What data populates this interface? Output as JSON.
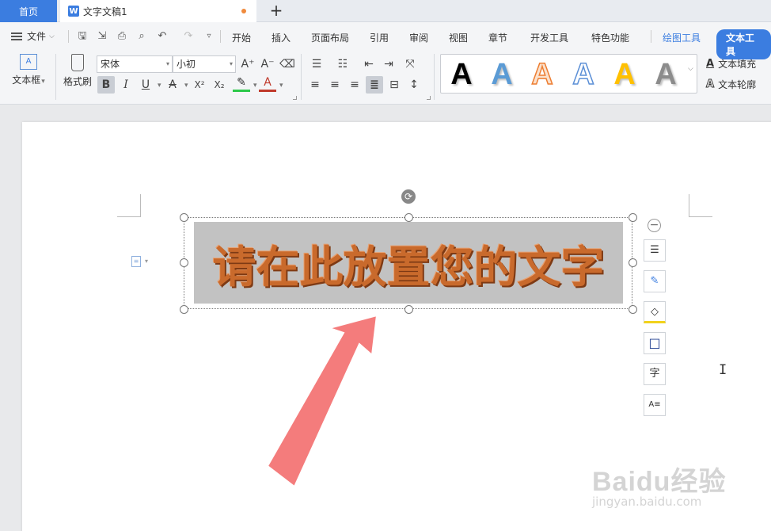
{
  "tabs": {
    "home": "首页",
    "doc_icon": "W",
    "doc_title": "文字文稿1",
    "new_tab": "+"
  },
  "menubar": {
    "file": "文件",
    "tabs": [
      "开始",
      "插入",
      "页面布局",
      "引用",
      "审阅",
      "视图",
      "章节",
      "开发工具",
      "特色功能"
    ],
    "drawing_tools": "绘图工具",
    "text_tools": "文本工具"
  },
  "toolbar": {
    "textbox_label": "文本框",
    "textbox_icon_glyph": "A",
    "format_painter_label": "格式刷",
    "font_name": "宋体",
    "font_size": "小初",
    "bold": "B",
    "italic": "I",
    "underline": "U",
    "strike": "A",
    "superscript": "X²",
    "subscript": "X₂",
    "font_color": "A",
    "grow_font": "A⁺",
    "shrink_font": "A⁻",
    "text_fill": "文本填充",
    "text_outline": "文本轮廓",
    "fill_glyph": "A",
    "outline_glyph": "A"
  },
  "wordart_styles": [
    {
      "glyph": "A",
      "color": "#000000"
    },
    {
      "glyph": "A",
      "color": "#5b9bd5"
    },
    {
      "glyph": "A",
      "color": "#ed7d31"
    },
    {
      "glyph": "A",
      "color": "#ffffff"
    },
    {
      "glyph": "A",
      "color": "#ffc000"
    },
    {
      "glyph": "A",
      "color": "#8c8c8c"
    }
  ],
  "document": {
    "textbox_text": "请在此放置您的文字",
    "text_color": "#c96a2c",
    "text_bg": "#c2c2c2",
    "paragraph_icon": "≡"
  },
  "float_toolbar": {
    "collapse": "−",
    "buttons": [
      "layout-icon",
      "brush-icon",
      "fill-icon",
      "border-icon",
      "text-direction-icon",
      "text-wrap-icon"
    ],
    "glyphs": [
      "☰",
      "✎",
      "◇",
      "□",
      "字",
      "A≡"
    ]
  },
  "watermark": {
    "logo": "Baidu经验",
    "url": "jingyan.baidu.com"
  },
  "colors": {
    "accent": "#3b7de0",
    "arrow": "#f47c7c"
  }
}
